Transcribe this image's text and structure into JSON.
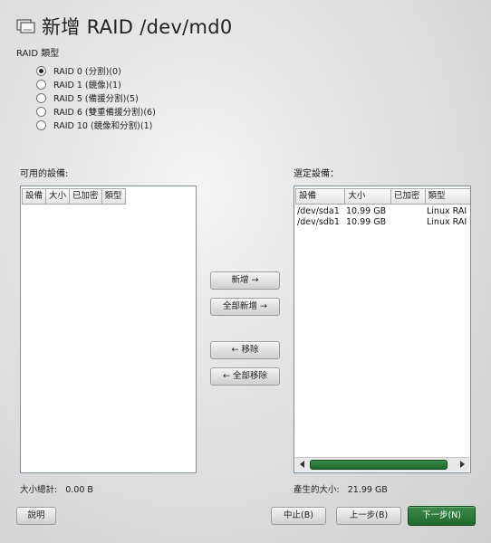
{
  "header": {
    "title": "新增 RAID /dev/md0"
  },
  "raid_type": {
    "label": "RAID 類型",
    "options": [
      {
        "label": "RAID 0 (分割)(0)",
        "checked": true
      },
      {
        "label": "RAID 1 (鏡像)(1)",
        "checked": false
      },
      {
        "label": "RAID 5 (備援分割)(5)",
        "checked": false
      },
      {
        "label": "RAID 6 (雙重備援分割)(6)",
        "checked": false
      },
      {
        "label": "RAID 10 (鏡像和分割)(1)",
        "checked": false
      }
    ]
  },
  "available": {
    "label": "可用的設備:",
    "columns": [
      "設備",
      "大小",
      "已加密",
      "類型"
    ],
    "total_label": "大小總計:",
    "total_value": "0.00 B"
  },
  "selected": {
    "label": "選定設備：",
    "columns": [
      "設備",
      "大小",
      "已加密",
      "類型"
    ],
    "rows": [
      {
        "device": "/dev/sda1",
        "size": "10.99 GB",
        "encrypted": "",
        "type": "Linux RAI"
      },
      {
        "device": "/dev/sdb1",
        "size": "10.99 GB",
        "encrypted": "",
        "type": "Linux RAI"
      }
    ],
    "size_label": "產生的大小:",
    "size_value": "21.99 GB"
  },
  "actions": {
    "add": "新增 →",
    "add_all": "全部新增 →",
    "remove": "← 移除",
    "remove_all": "← 全部移除"
  },
  "footer": {
    "help": "說明",
    "abort": "中止(B)",
    "back": "上一步(B)",
    "next": "下一步(N)"
  },
  "colors": {
    "accent": "#1d6a2c",
    "list_border": "#7a8ea6"
  }
}
